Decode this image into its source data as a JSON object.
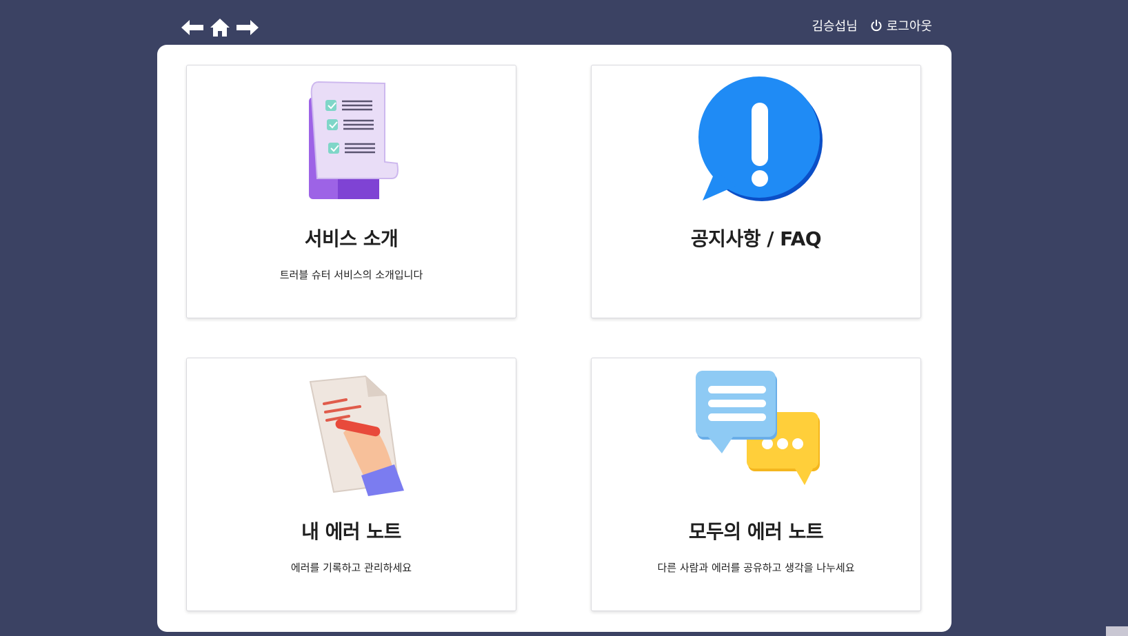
{
  "header": {
    "back_icon": "arrow-left-icon",
    "home_icon": "home-icon",
    "forward_icon": "arrow-right-icon",
    "user_name": "김승섭님",
    "logout_label": "로그아웃",
    "logout_icon": "power-icon"
  },
  "cards": [
    {
      "title": "서비스 소개",
      "desc": "트러블 슈터 서비스의 소개입니다",
      "icon": "checklist-document-icon"
    },
    {
      "title": "공지사항 / FAQ",
      "desc": "",
      "icon": "exclamation-speech-bubble-icon"
    },
    {
      "title": "내 에러 노트",
      "desc": "에러를 기록하고 관리하세요",
      "icon": "hand-writing-note-icon"
    },
    {
      "title": "모두의 에러 노트",
      "desc": "다른 사람과 에러를 공유하고 생각을 나누세요",
      "icon": "chat-bubbles-icon"
    }
  ],
  "colors": {
    "background": "#3b4263",
    "panel": "#ffffff",
    "text": "#1f1f1f"
  }
}
